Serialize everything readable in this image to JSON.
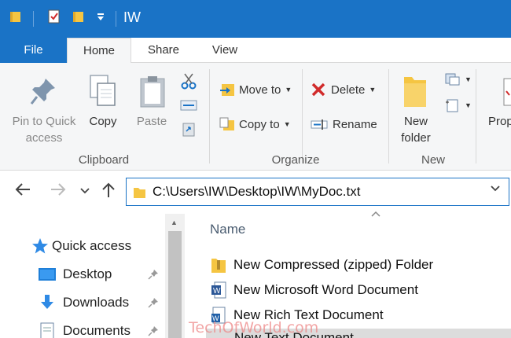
{
  "window": {
    "title": "IW"
  },
  "tabs": {
    "file": "File",
    "home": "Home",
    "share": "Share",
    "view": "View"
  },
  "ribbon": {
    "clipboard": {
      "pin_label_line1": "Pin to Quick",
      "pin_label_line2": "access",
      "copy_label": "Copy",
      "paste_label": "Paste",
      "group_label": "Clipboard"
    },
    "organize": {
      "move_to_label": "Move to",
      "copy_to_label": "Copy to",
      "delete_label": "Delete",
      "rename_label": "Rename",
      "group_label": "Organize"
    },
    "new": {
      "new_folder_line1": "New",
      "new_folder_line2": "folder",
      "group_label": "New"
    },
    "open": {
      "properties_label": "Prop"
    }
  },
  "address_bar": {
    "path": "C:\\Users\\IW\\Desktop\\IW\\MyDoc.txt"
  },
  "nav_pane": {
    "items": [
      {
        "label": "Quick access",
        "icon": "star-icon"
      },
      {
        "label": "Desktop",
        "icon": "desktop-icon"
      },
      {
        "label": "Downloads",
        "icon": "download-arrow-icon"
      },
      {
        "label": "Documents",
        "icon": "document-icon"
      }
    ]
  },
  "file_list": {
    "column_name": "Name",
    "items": [
      {
        "label": "New Compressed (zipped) Folder",
        "icon": "zip-folder-icon"
      },
      {
        "label": "New Microsoft Word Document",
        "icon": "word-doc-icon"
      },
      {
        "label": "New Rich Text Document",
        "icon": "wordpad-doc-icon"
      },
      {
        "label": "New Text Document",
        "icon": "text-doc-icon"
      }
    ]
  },
  "watermark": "TechOfWorld.com",
  "colors": {
    "accent": "#1a73c6",
    "folder": "#f5c542",
    "delete_red": "#d12b2b"
  }
}
